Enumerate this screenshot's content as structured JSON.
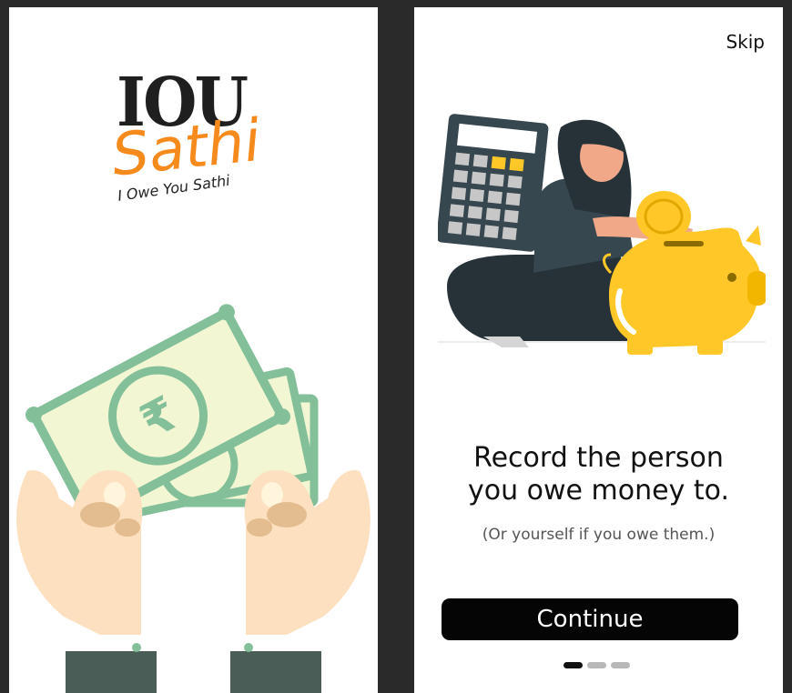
{
  "splash": {
    "logo": {
      "word1": "IOU",
      "word2": "Sathi",
      "tagline": "I Owe You Sathi"
    },
    "illustration": "hands-holding-rupee-notes"
  },
  "onboarding": {
    "skip_label": "Skip",
    "illustration": "woman-calculator-piggy-bank",
    "headline_line1": "Record the person",
    "headline_line2": "you owe money to.",
    "subtext": "(Or yourself if you owe them.)",
    "continue_label": "Continue",
    "pagination": {
      "total": 3,
      "active": 1
    }
  },
  "colors": {
    "brand_orange": "#f78a1c",
    "note_green": "#83c09a",
    "note_fill": "#f3f6d2",
    "skin": "#fde0bf",
    "coin_yellow": "#ffc727",
    "button_black": "#050505"
  }
}
